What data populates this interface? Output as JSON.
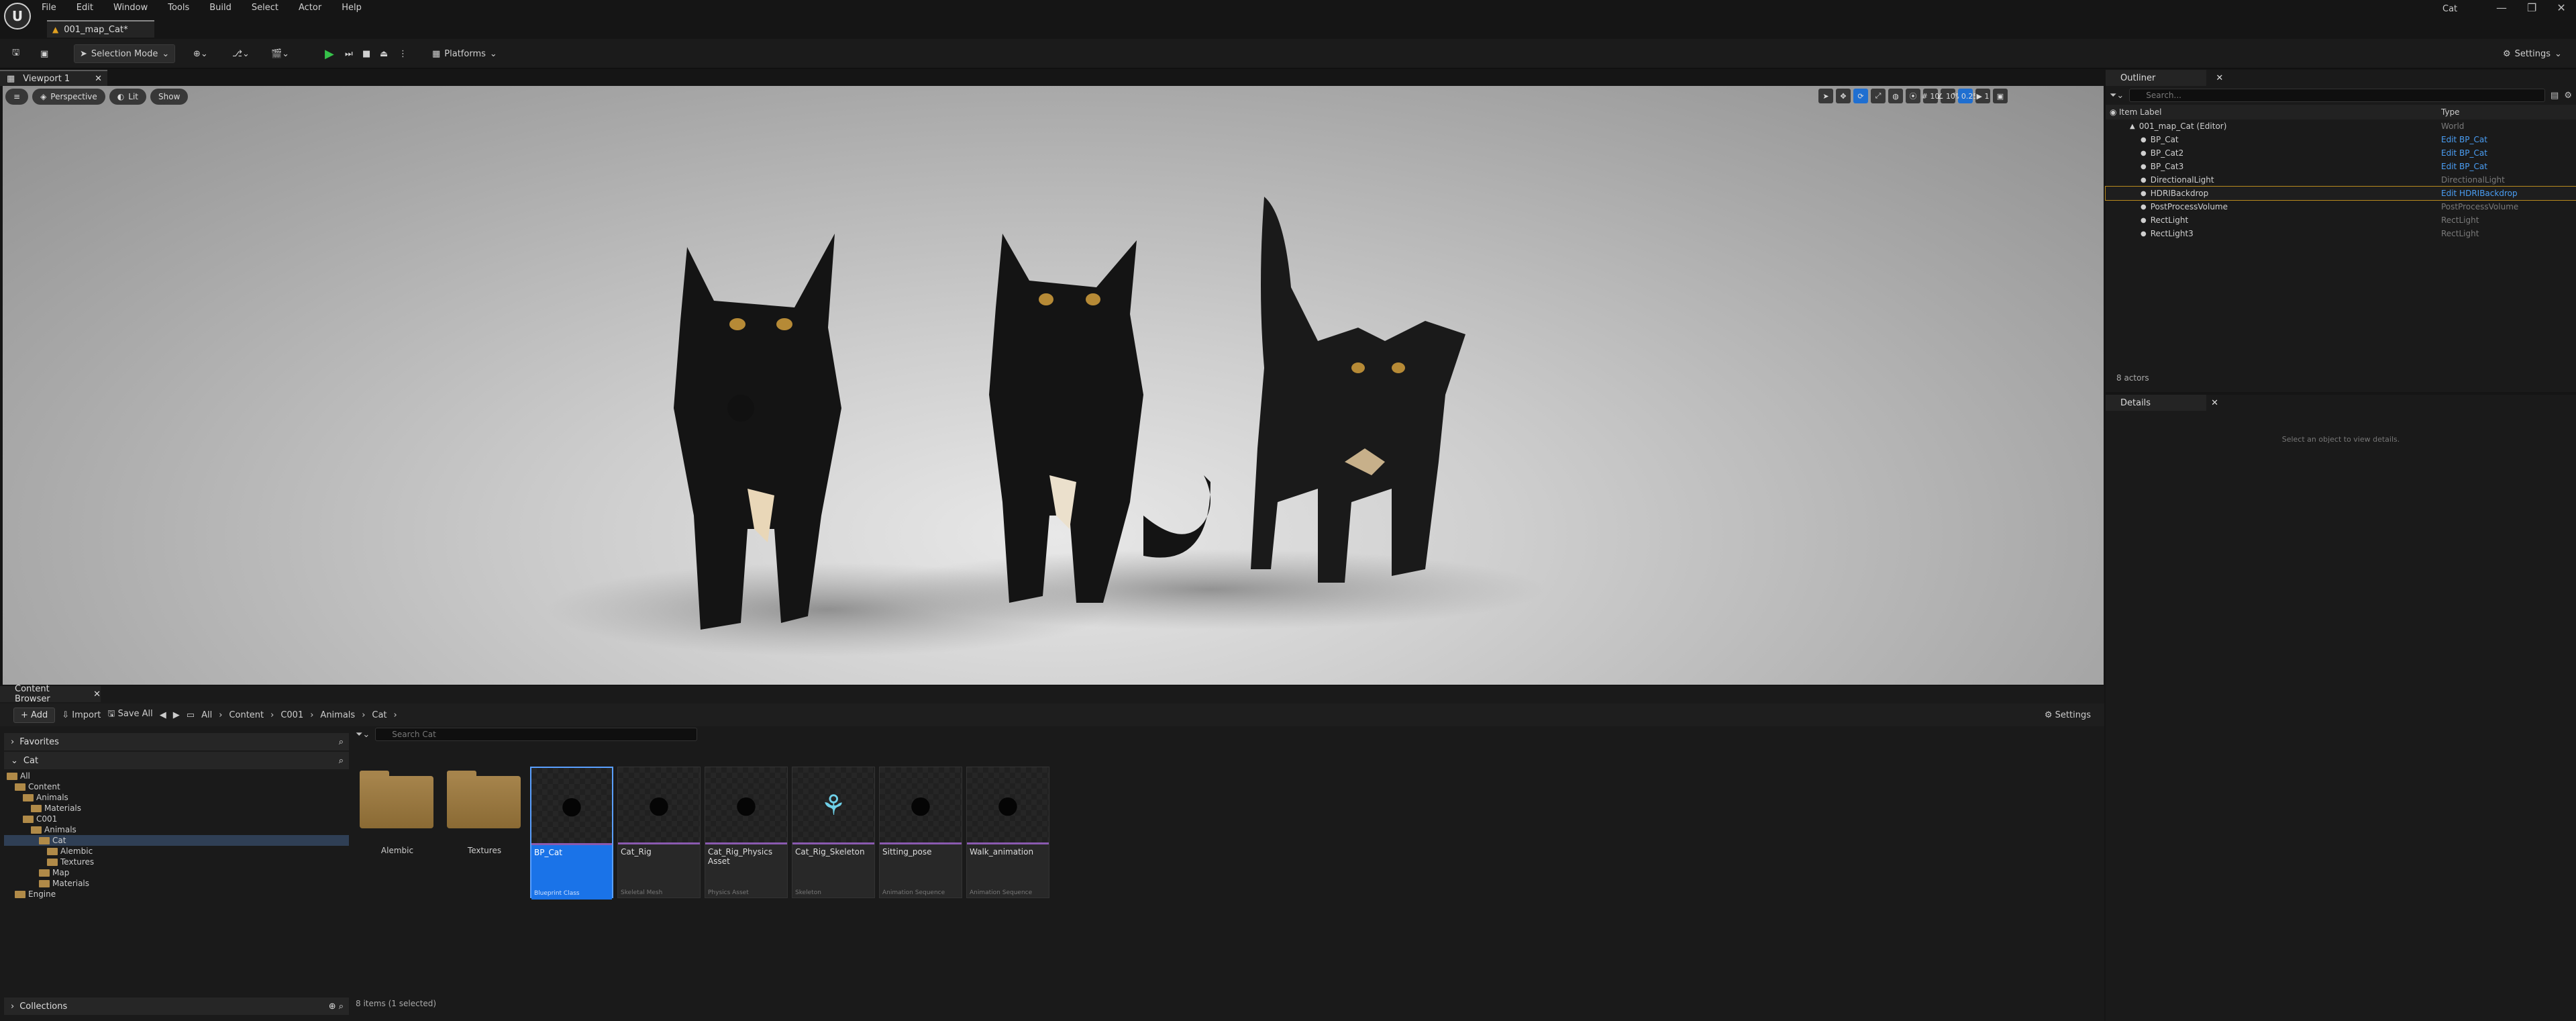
{
  "window": {
    "app_title": "Cat",
    "tab": "001_map_Cat*"
  },
  "menu": [
    "File",
    "Edit",
    "Window",
    "Tools",
    "Build",
    "Select",
    "Actor",
    "Help"
  ],
  "toolbar": {
    "mode": "Selection Mode",
    "platforms": "Platforms",
    "settings": "Settings"
  },
  "viewport": {
    "tab": "Viewport 1",
    "perspective": "Perspective",
    "lit": "Lit",
    "show": "Show",
    "grid": "10",
    "angle": "10°",
    "scale": "0.25",
    "cam": "1"
  },
  "outliner": {
    "tab": "Outliner",
    "search_placeholder": "Search...",
    "col_label": "Item Label",
    "col_type": "Type",
    "count": "8 actors",
    "rows": [
      {
        "label": "001_map_Cat (Editor)",
        "type": "World"
      },
      {
        "label": "BP_Cat",
        "type": "Edit BP_Cat"
      },
      {
        "label": "BP_Cat2",
        "type": "Edit BP_Cat"
      },
      {
        "label": "BP_Cat3",
        "type": "Edit BP_Cat"
      },
      {
        "label": "DirectionalLight",
        "type": "DirectionalLight"
      },
      {
        "label": "HDRIBackdrop",
        "type": "Edit HDRIBackdrop"
      },
      {
        "label": "PostProcessVolume",
        "type": "PostProcessVolume"
      },
      {
        "label": "RectLight",
        "type": "RectLight"
      },
      {
        "label": "RectLight3",
        "type": "RectLight"
      }
    ]
  },
  "details": {
    "tab": "Details",
    "empty": "Select an object to view details."
  },
  "content_browser": {
    "tab": "Content Browser",
    "add": "Add",
    "import": "Import",
    "save_all": "Save All",
    "settings": "Settings",
    "path": [
      "All",
      "Content",
      "C001",
      "Animals",
      "Cat"
    ],
    "search_placeholder": "Search Cat",
    "favorites": "Favorites",
    "source": "Cat",
    "collections": "Collections",
    "status": "8 items (1 selected)",
    "tree": [
      {
        "label": "All",
        "level": 0
      },
      {
        "label": "Content",
        "level": 1
      },
      {
        "label": "Animals",
        "level": 2
      },
      {
        "label": "Materials",
        "level": 3
      },
      {
        "label": "C001",
        "level": 2
      },
      {
        "label": "Animals",
        "level": 3
      },
      {
        "label": "Cat",
        "level": 4
      },
      {
        "label": "Alembic",
        "level": 5
      },
      {
        "label": "Textures",
        "level": 5
      },
      {
        "label": "Map",
        "level": 4
      },
      {
        "label": "Materials",
        "level": 4
      },
      {
        "label": "Engine",
        "level": 1
      }
    ],
    "folders": [
      "Alembic",
      "Textures"
    ],
    "assets": [
      {
        "name": "BP_Cat",
        "kind": "Blueprint Class"
      },
      {
        "name": "Cat_Rig",
        "kind": "Skeletal Mesh"
      },
      {
        "name": "Cat_Rig_Physics Asset",
        "kind": "Physics Asset"
      },
      {
        "name": "Cat_Rig_Skeleton",
        "kind": "Skeleton"
      },
      {
        "name": "Sitting_pose",
        "kind": "Animation Sequence"
      },
      {
        "name": "Walk_animation",
        "kind": "Animation Sequence"
      }
    ]
  }
}
